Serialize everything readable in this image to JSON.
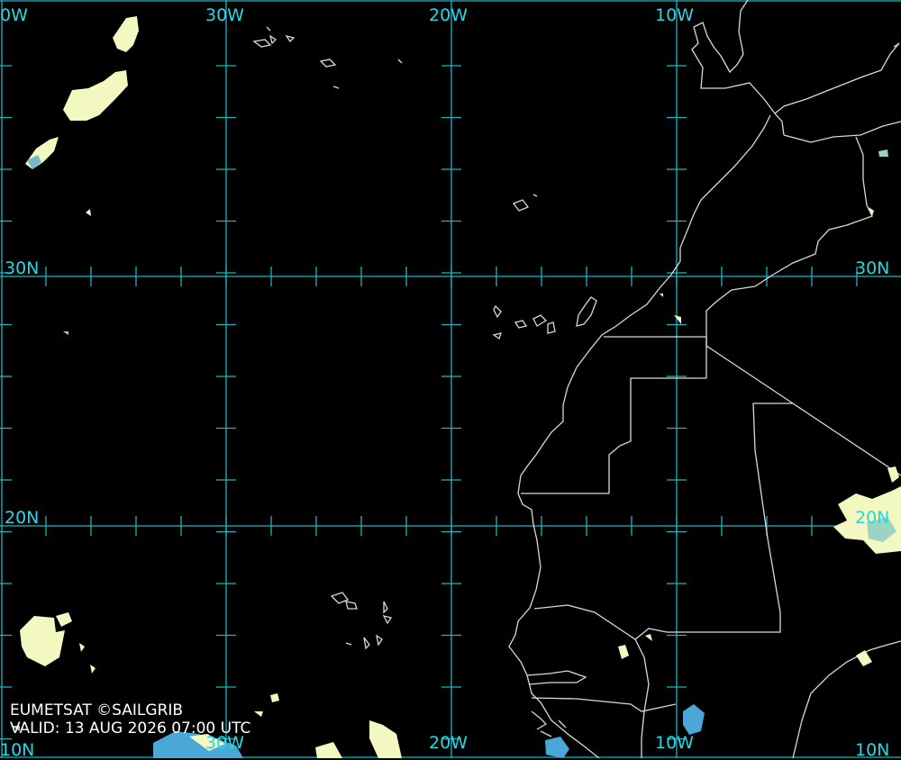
{
  "colors": {
    "background": "#000000",
    "grid": "#1fb5bf",
    "grid_label": "#27d7e3",
    "coastline": "#d9d9d9",
    "cloud_warm": "#f2f8c0",
    "cloud_mid": "#9dd3c2",
    "cloud_cold": "#4aa8d8",
    "credit_text": "#ffffff"
  },
  "grid_labels": {
    "lon_top": [
      "0W",
      "30W",
      "20W",
      "10W"
    ],
    "lat_left": [
      "30N",
      "20N"
    ],
    "lat_right": [
      "30N",
      "20N",
      "10N"
    ],
    "lat_left_bottom": "10N",
    "lon_bottom": [
      "30W",
      "20W",
      "10W"
    ]
  },
  "credit": {
    "source": "EUMETSAT ©SAILGRIB",
    "valid": "VALID:  13 AUG 2026 07:00 UTC"
  }
}
